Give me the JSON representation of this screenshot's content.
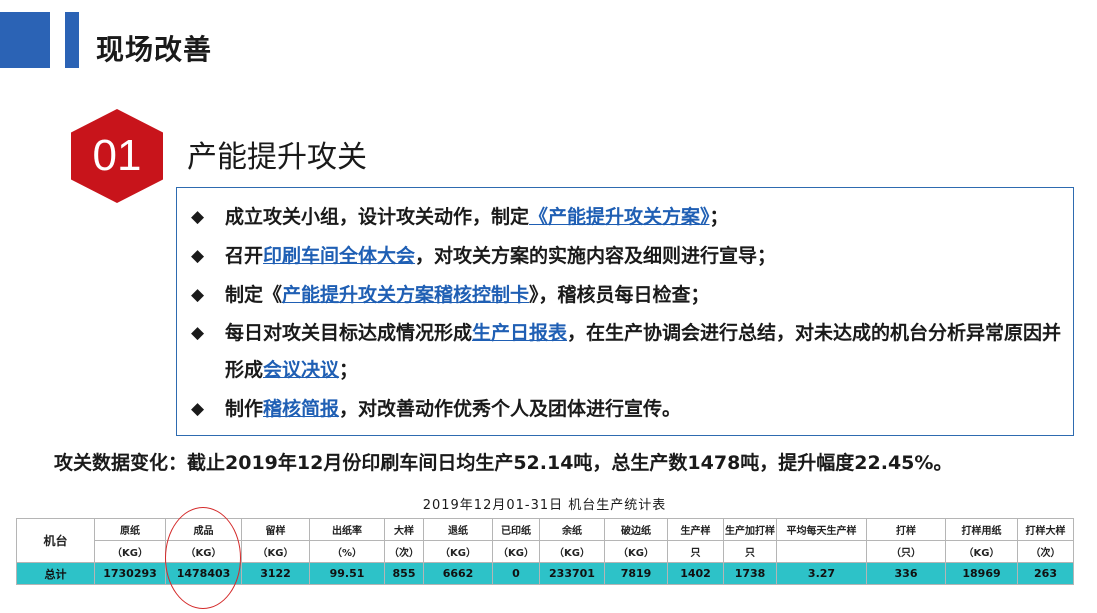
{
  "header": {
    "title": "现场改善"
  },
  "section": {
    "number": "01",
    "title": "产能提升攻关"
  },
  "bullets": [
    {
      "parts": [
        "成立攻关小组，设计攻关动作，制定",
        "《产能提升攻关方案》",
        "；"
      ]
    },
    {
      "parts": [
        "召开",
        "印刷车间全体大会",
        "，对攻关方案的实施内容及细则进行宣导；"
      ]
    },
    {
      "parts": [
        "制定《",
        "产能提升攻关方案稽核控制卡",
        "》，稽核员每日检查；"
      ]
    },
    {
      "parts": [
        "每日对攻关目标达成情况形成",
        "生产日报表",
        "，在生产协调会进行总结，对未达成的机台分析异常原因并形成",
        "会议决议",
        "；"
      ]
    },
    {
      "parts": [
        "制作",
        "稽核简报",
        "，对改善动作优秀个人及团体进行宣传。"
      ]
    }
  ],
  "stat_text": "攻关数据变化：截止2019年12月份印刷车间日均生产52.14吨，总生产数1478吨，提升幅度22.45%。",
  "table": {
    "title": "2019年12月01-31日  机台生产统计表",
    "first_col": "机台",
    "headers": [
      {
        "label": "原纸",
        "unit": "（KG）"
      },
      {
        "label": "成品",
        "unit": "（KG）"
      },
      {
        "label": "留样",
        "unit": "（KG）"
      },
      {
        "label": "出纸率",
        "unit": "（%）"
      },
      {
        "label": "大样",
        "unit": "（次）"
      },
      {
        "label": "退纸",
        "unit": "（KG）"
      },
      {
        "label": "已印纸",
        "unit": "（KG）"
      },
      {
        "label": "余纸",
        "unit": "（KG）"
      },
      {
        "label": "破边纸",
        "unit": "（KG）"
      },
      {
        "label": "生产样",
        "unit": "只"
      },
      {
        "label": "生产加打样",
        "unit": "只"
      },
      {
        "label": "平均每天生产样",
        "unit": ""
      },
      {
        "label": "打样",
        "unit": "（只）"
      },
      {
        "label": "打样用纸",
        "unit": "（KG）"
      },
      {
        "label": "打样大样",
        "unit": "（次）"
      }
    ],
    "total_label": "总计",
    "total_values": [
      "1730293",
      "1478403",
      "3122",
      "99.51",
      "855",
      "6662",
      "0",
      "233701",
      "7819",
      "1402",
      "1738",
      "3.27",
      "336",
      "18969",
      "263"
    ]
  },
  "colors": {
    "accent": "#2b63b5",
    "hexagon": "#c8141b",
    "link": "#1f5fb4",
    "table_total": "#2dc2c8",
    "circle": "#d42a2a"
  }
}
